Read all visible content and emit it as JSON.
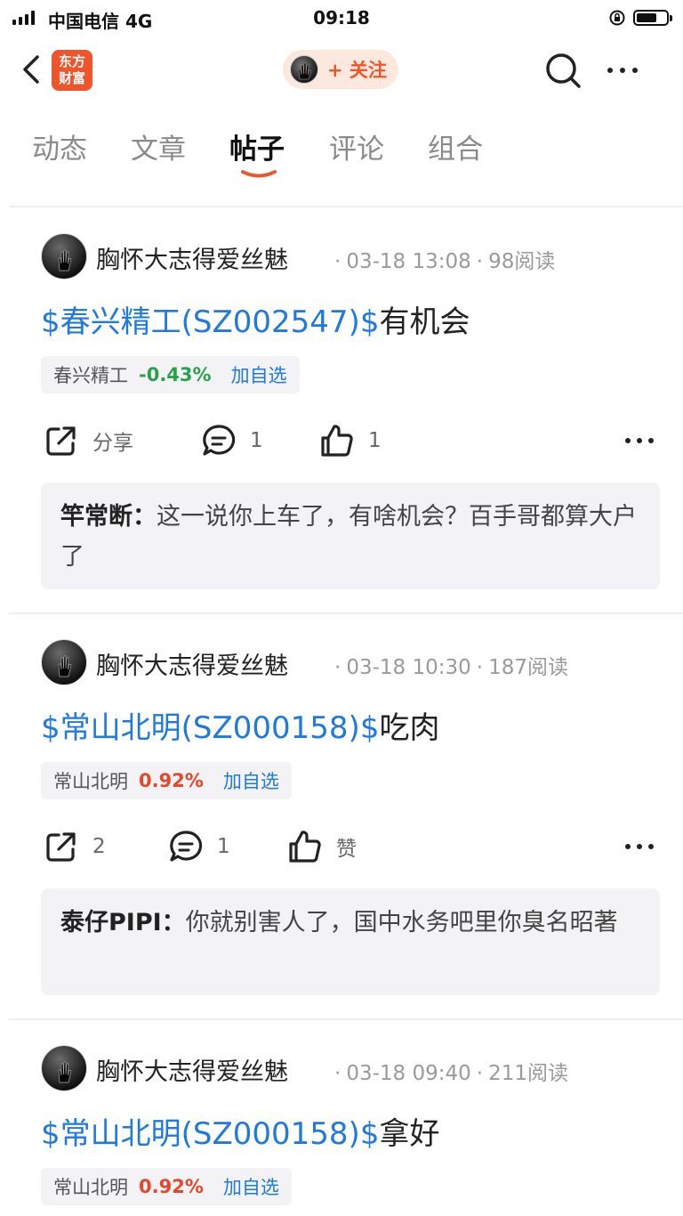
{
  "status_bar": {
    "carrier": "中国电信 4G",
    "time": "09:18"
  },
  "header": {
    "logo_line1": "东方",
    "logo_line2": "财富",
    "follow_label": "+ 关注"
  },
  "tabs": [
    {
      "label": "动态",
      "active": false
    },
    {
      "label": "文章",
      "active": false
    },
    {
      "label": "帖子",
      "active": true
    },
    {
      "label": "评论",
      "active": false
    },
    {
      "label": "组合",
      "active": false
    }
  ],
  "colors": {
    "accent": "#f0542a",
    "link": "#1f79e0",
    "down": "#2aa14a",
    "up": "#e5472b"
  },
  "posts": [
    {
      "author": "胸怀大志得爱丝魅",
      "date": "03-18 13:08",
      "reads": "98阅读",
      "title_link": "$春兴精工(SZ002547)$",
      "title_text": "有机会",
      "chip_name": "春兴精工",
      "chip_change": "-0.43%",
      "chip_add": "加自选",
      "share_label": "分享",
      "comment_count": "1",
      "like_label": "1",
      "comment_user": "竿常断",
      "comment_text": "这一说你上车了，有啥机会？百手哥都算大户了"
    },
    {
      "author": "胸怀大志得爱丝魅",
      "date": "03-18 10:30",
      "reads": "187阅读",
      "title_link": "$常山北明(SZ000158)$",
      "title_text": "吃肉",
      "chip_name": "常山北明",
      "chip_change": "0.92%",
      "chip_add": "加自选",
      "share_label": "2",
      "comment_count": "1",
      "like_label": "赞",
      "comment_user": "泰仔PIPI",
      "comment_text": "你就别害人了，国中水务吧里你臭名昭著"
    },
    {
      "author": "胸怀大志得爱丝魅",
      "date": "03-18 09:40",
      "reads": "211阅读",
      "title_link": "$常山北明(SZ000158)$",
      "title_text": "拿好",
      "chip_name": "常山北明",
      "chip_change": "0.92%",
      "chip_add": "加自选"
    }
  ]
}
